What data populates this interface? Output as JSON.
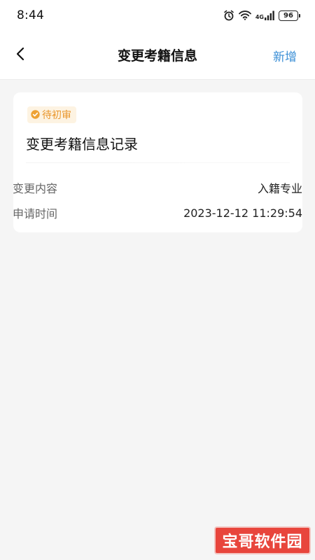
{
  "status_bar": {
    "time": "8:44",
    "network_label": "4G",
    "battery": "96"
  },
  "nav": {
    "title": "变更考籍信息",
    "action_label": "新增"
  },
  "record": {
    "status_badge": "待初审",
    "title": "变更考籍信息记录",
    "fields": [
      {
        "label": "变更内容",
        "value": "入籍专业"
      },
      {
        "label": "申请时间",
        "value": "2023-12-12 11:29:54"
      }
    ]
  },
  "watermark": {
    "text": "宝哥软件园"
  },
  "colors": {
    "accent_link": "#3b8fd6",
    "badge_text": "#e9952a",
    "badge_bg": "#fdf3e2",
    "page_bg": "#f5f5f5",
    "card_bg": "#ffffff"
  }
}
